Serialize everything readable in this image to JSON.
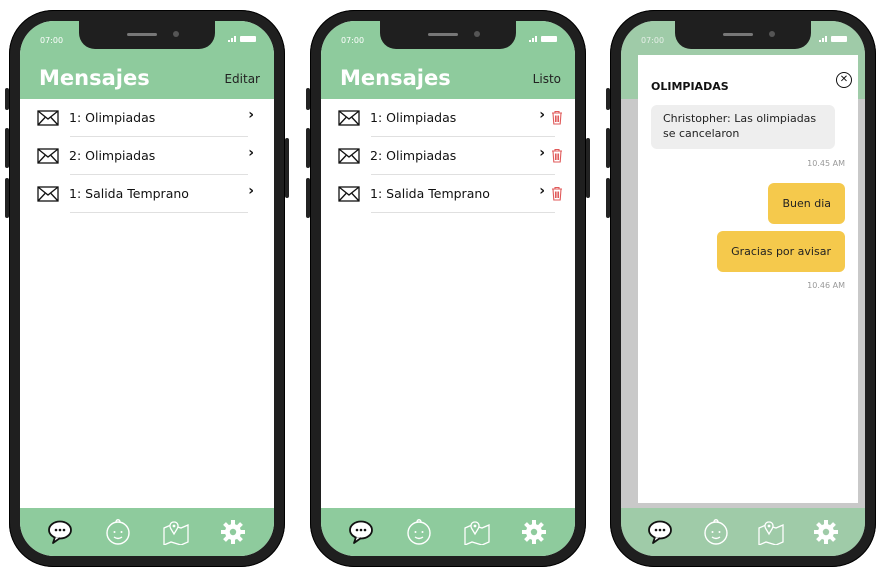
{
  "status": {
    "time": "07:00"
  },
  "screens": {
    "list": {
      "title": "Mensajes",
      "action_label": "Editar",
      "items": [
        {
          "label": "1: Olimpiadas"
        },
        {
          "label": "2: Olimpiadas"
        },
        {
          "label": "1: Salida Temprano"
        }
      ]
    },
    "edit": {
      "title": "Mensajes",
      "action_label": "Listo",
      "items": [
        {
          "label": "1: Olimpiadas"
        },
        {
          "label": "2: Olimpiadas"
        },
        {
          "label": "1: Salida Temprano"
        }
      ]
    },
    "chat": {
      "title": "OLIMPIADAS",
      "messages": [
        {
          "from": "in",
          "text": "Christopher: Las olimpiadas se cancelaron",
          "time": "10.45 AM"
        },
        {
          "from": "out",
          "text": "Buen dia"
        },
        {
          "from": "out",
          "text": "Gracias por avisar",
          "time": "10.46 AM"
        }
      ]
    }
  },
  "tabbar": {
    "icons": [
      "chat-bubble-icon",
      "baby-face-icon",
      "map-pin-icon",
      "gear-icon"
    ]
  },
  "colors": {
    "header_green": "#8ecb9d",
    "bubble_out": "#f5c94c",
    "bubble_in": "#eeeeee",
    "trash_red": "#e05a5a"
  }
}
